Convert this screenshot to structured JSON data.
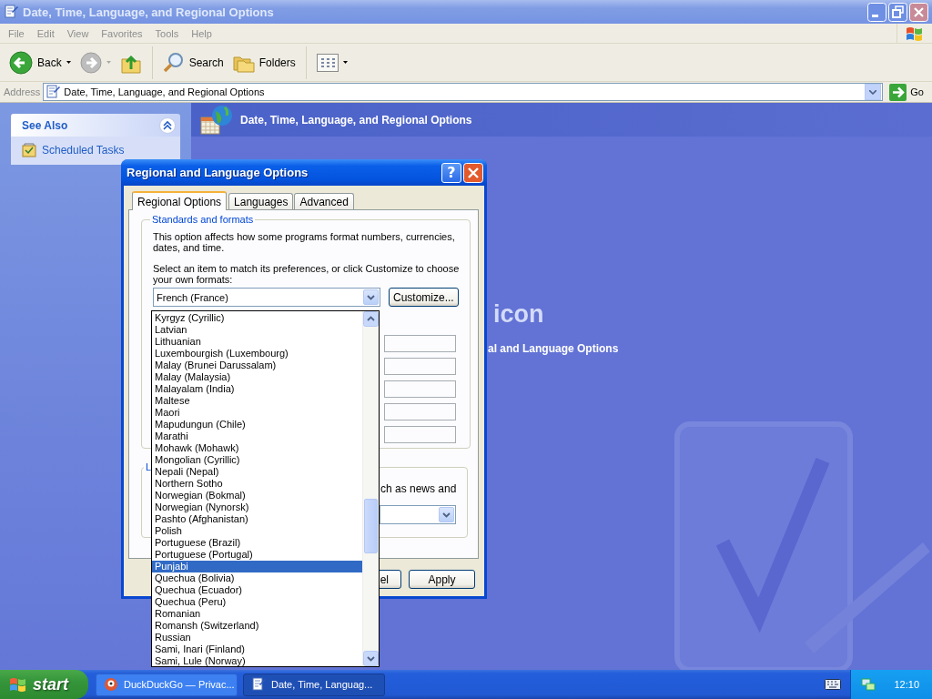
{
  "window": {
    "title": "Date, Time, Language, and Regional Options"
  },
  "menu": [
    "File",
    "Edit",
    "View",
    "Favorites",
    "Tools",
    "Help"
  ],
  "toolbar": {
    "back": "Back",
    "search": "Search",
    "folders": "Folders"
  },
  "address": {
    "label": "Address",
    "value": "Date, Time, Language, and Regional Options",
    "go": "Go"
  },
  "sidebar": {
    "panel_title": "See Also",
    "expanded": true,
    "links": [
      "Scheduled Tasks"
    ]
  },
  "content": {
    "title": "Date, Time, Language, and Regional Options",
    "partial_heading": "icon",
    "partial_link": "al and Language Options"
  },
  "dialog": {
    "title": "Regional and Language Options",
    "help_button": "?",
    "tabs": [
      {
        "label": "Regional Options",
        "selected": true
      },
      {
        "label": "Languages",
        "selected": false
      },
      {
        "label": "Advanced",
        "selected": false
      }
    ],
    "group_title": "Standards and formats",
    "description": "This option affects how some programs format numbers, currencies, dates, and time.",
    "instruction": "Select an item to match its preferences, or click Customize to choose your own formats:",
    "format_combo": {
      "value": "French (France)"
    },
    "customize_button": "Customize...",
    "dropdown": {
      "items": [
        {
          "label": "Kyrgyz (Cyrillic)",
          "selected": false
        },
        {
          "label": "Latvian",
          "selected": false
        },
        {
          "label": "Lithuanian",
          "selected": false
        },
        {
          "label": "Luxembourgish (Luxembourg)",
          "selected": false
        },
        {
          "label": "Malay (Brunei Darussalam)",
          "selected": false
        },
        {
          "label": "Malay (Malaysia)",
          "selected": false
        },
        {
          "label": "Malayalam (India)",
          "selected": false
        },
        {
          "label": "Maltese",
          "selected": false
        },
        {
          "label": "Maori",
          "selected": false
        },
        {
          "label": "Mapudungun (Chile)",
          "selected": false
        },
        {
          "label": "Marathi",
          "selected": false
        },
        {
          "label": "Mohawk (Mohawk)",
          "selected": false
        },
        {
          "label": "Mongolian (Cyrillic)",
          "selected": false
        },
        {
          "label": "Nepali (Nepal)",
          "selected": false
        },
        {
          "label": "Northern Sotho",
          "selected": false
        },
        {
          "label": "Norwegian (Bokmal)",
          "selected": false
        },
        {
          "label": "Norwegian (Nynorsk)",
          "selected": false
        },
        {
          "label": "Pashto (Afghanistan)",
          "selected": false
        },
        {
          "label": "Polish",
          "selected": false
        },
        {
          "label": "Portuguese (Brazil)",
          "selected": false
        },
        {
          "label": "Portuguese (Portugal)",
          "selected": false
        },
        {
          "label": "Punjabi",
          "selected": true
        },
        {
          "label": "Quechua (Bolivia)",
          "selected": false
        },
        {
          "label": "Quechua (Ecuador)",
          "selected": false
        },
        {
          "label": "Quechua (Peru)",
          "selected": false
        },
        {
          "label": "Romanian",
          "selected": false
        },
        {
          "label": "Romansh (Switzerland)",
          "selected": false
        },
        {
          "label": "Russian",
          "selected": false
        },
        {
          "label": "Sami, Inari (Finland)",
          "selected": false
        },
        {
          "label": "Sami, Lule (Norway)",
          "selected": false
        }
      ]
    },
    "location_group": {
      "legend": "L",
      "text": "ch as news and"
    },
    "buttons": [
      "el",
      "Apply"
    ]
  },
  "taskbar": {
    "start": "start",
    "tasks": [
      {
        "label": "DuckDuckGo — Privac...",
        "selected": false
      },
      {
        "label": "Date, Time, Languag...",
        "selected": true
      }
    ],
    "clock": "12:10"
  }
}
